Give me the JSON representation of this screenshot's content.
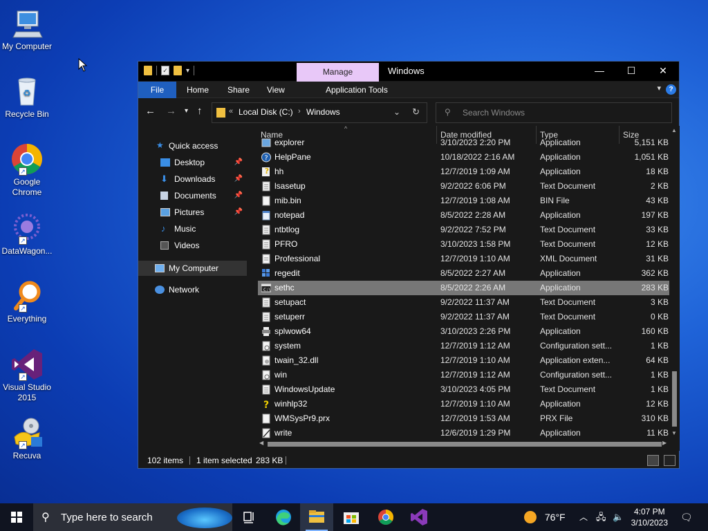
{
  "desktop": {
    "icons": [
      {
        "label": "My Computer"
      },
      {
        "label": "Recycle Bin"
      },
      {
        "label": "Google Chrome"
      },
      {
        "label": "DataWagon..."
      },
      {
        "label": "Everything"
      },
      {
        "label": "Visual Studio 2015"
      },
      {
        "label": "Recuva"
      }
    ]
  },
  "window": {
    "title": "Windows",
    "manage_tab": "Manage",
    "ribbon_tabs": [
      "File",
      "Home",
      "Share",
      "View",
      "Application Tools"
    ],
    "address": [
      "Local Disk (C:)",
      "Windows"
    ],
    "search_placeholder": "Search Windows",
    "nav": {
      "quick_access": "Quick access",
      "items": [
        "Desktop",
        "Downloads",
        "Documents",
        "Pictures",
        "Music",
        "Videos"
      ],
      "my_computer": "My Computer",
      "network": "Network"
    },
    "columns": [
      "Name",
      "Date modified",
      "Type",
      "Size"
    ],
    "files": [
      {
        "name": "explorer",
        "date": "3/10/2023 2:20 PM",
        "type": "Application",
        "size": "5,151 KB",
        "icon": "app-icon"
      },
      {
        "name": "HelpPane",
        "date": "10/18/2022 2:16 AM",
        "type": "Application",
        "size": "1,051 KB",
        "icon": "help-icon"
      },
      {
        "name": "hh",
        "date": "12/7/2019 1:09 AM",
        "type": "Application",
        "size": "18 KB",
        "icon": "help-doc-icon"
      },
      {
        "name": "lsasetup",
        "date": "9/2/2022 6:06 PM",
        "type": "Text Document",
        "size": "2 KB",
        "icon": "text-doc-icon"
      },
      {
        "name": "mib.bin",
        "date": "12/7/2019 1:08 AM",
        "type": "BIN File",
        "size": "43 KB",
        "icon": "file-icon"
      },
      {
        "name": "notepad",
        "date": "8/5/2022 2:28 AM",
        "type": "Application",
        "size": "197 KB",
        "icon": "notepad-icon"
      },
      {
        "name": "ntbtlog",
        "date": "9/2/2022 7:52 PM",
        "type": "Text Document",
        "size": "33 KB",
        "icon": "text-doc-icon"
      },
      {
        "name": "PFRO",
        "date": "3/10/2023 1:58 PM",
        "type": "Text Document",
        "size": "12 KB",
        "icon": "text-doc-icon"
      },
      {
        "name": "Professional",
        "date": "12/7/2019 1:10 AM",
        "type": "XML Document",
        "size": "31 KB",
        "icon": "xml-doc-icon"
      },
      {
        "name": "regedit",
        "date": "8/5/2022 2:27 AM",
        "type": "Application",
        "size": "362 KB",
        "icon": "regedit-icon"
      },
      {
        "name": "sethc",
        "date": "8/5/2022 2:26 AM",
        "type": "Application",
        "size": "283 KB",
        "icon": "console-icon",
        "selected": true
      },
      {
        "name": "setupact",
        "date": "9/2/2022 11:37 AM",
        "type": "Text Document",
        "size": "3 KB",
        "icon": "text-doc-icon"
      },
      {
        "name": "setuperr",
        "date": "9/2/2022 11:37 AM",
        "type": "Text Document",
        "size": "0 KB",
        "icon": "text-doc-icon"
      },
      {
        "name": "splwow64",
        "date": "3/10/2023 2:26 PM",
        "type": "Application",
        "size": "160 KB",
        "icon": "printer-icon"
      },
      {
        "name": "system",
        "date": "12/7/2019 1:12 AM",
        "type": "Configuration sett...",
        "size": "1 KB",
        "icon": "config-icon"
      },
      {
        "name": "twain_32.dll",
        "date": "12/7/2019 1:10 AM",
        "type": "Application exten...",
        "size": "64 KB",
        "icon": "dll-icon"
      },
      {
        "name": "win",
        "date": "12/7/2019 1:12 AM",
        "type": "Configuration sett...",
        "size": "1 KB",
        "icon": "config-icon"
      },
      {
        "name": "WindowsUpdate",
        "date": "3/10/2023 4:05 PM",
        "type": "Text Document",
        "size": "1 KB",
        "icon": "text-doc-icon"
      },
      {
        "name": "winhlp32",
        "date": "12/7/2019 1:10 AM",
        "type": "Application",
        "size": "12 KB",
        "icon": "help-question-icon"
      },
      {
        "name": "WMSysPr9.prx",
        "date": "12/7/2019 1:53 AM",
        "type": "PRX File",
        "size": "310 KB",
        "icon": "file-icon"
      },
      {
        "name": "write",
        "date": "12/6/2019 1:29 PM",
        "type": "Application",
        "size": "11 KB",
        "icon": "write-icon"
      }
    ],
    "status": {
      "items": "102 items",
      "selected": "1 item selected",
      "size": "283 KB"
    }
  },
  "taskbar": {
    "search_placeholder": "Type here to search",
    "weather": "76°F",
    "time": "4:07 PM",
    "date": "3/10/2023"
  }
}
